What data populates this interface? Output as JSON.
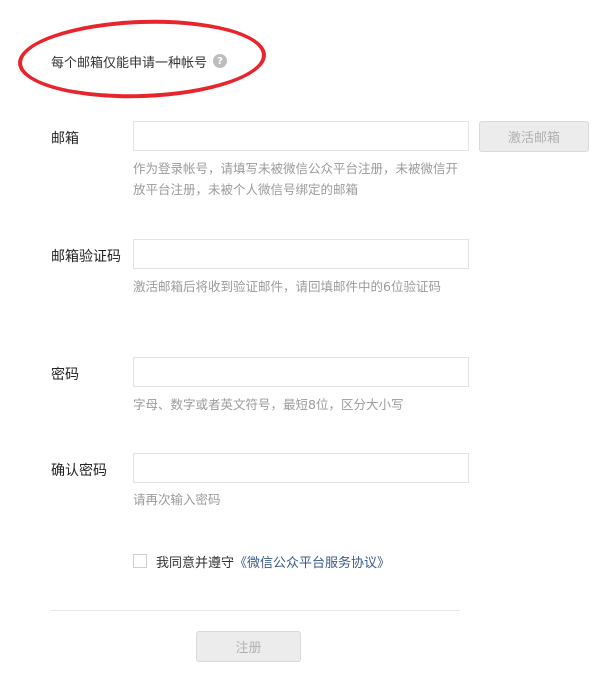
{
  "notice": {
    "text": "每个邮箱仅能申请一种帐号",
    "help_icon": "?"
  },
  "form": {
    "email": {
      "label": "邮箱",
      "value": "",
      "placeholder": "",
      "activate_label": "激活邮箱",
      "hint": "作为登录帐号，请填写未被微信公众平台注册，未被微信开放平台注册，未被个人微信号绑定的邮箱"
    },
    "verify_code": {
      "label": "邮箱验证码",
      "value": "",
      "placeholder": "",
      "hint": "激活邮箱后将收到验证邮件，请回填邮件中的6位验证码"
    },
    "password": {
      "label": "密码",
      "value": "",
      "placeholder": "",
      "hint": "字母、数字或者英文符号，最短8位，区分大小写"
    },
    "confirm_password": {
      "label": "确认密码",
      "value": "",
      "placeholder": "",
      "hint": "请再次输入密码"
    }
  },
  "agreement": {
    "checked": false,
    "prefix": "我同意并遵守",
    "link": "《微信公众平台服务协议》"
  },
  "submit": {
    "label": "注册"
  },
  "colors": {
    "annotation": "#e8242c",
    "link": "#3a5a8c",
    "hint": "#9b9b9b",
    "disabled_button": "#ececec"
  }
}
